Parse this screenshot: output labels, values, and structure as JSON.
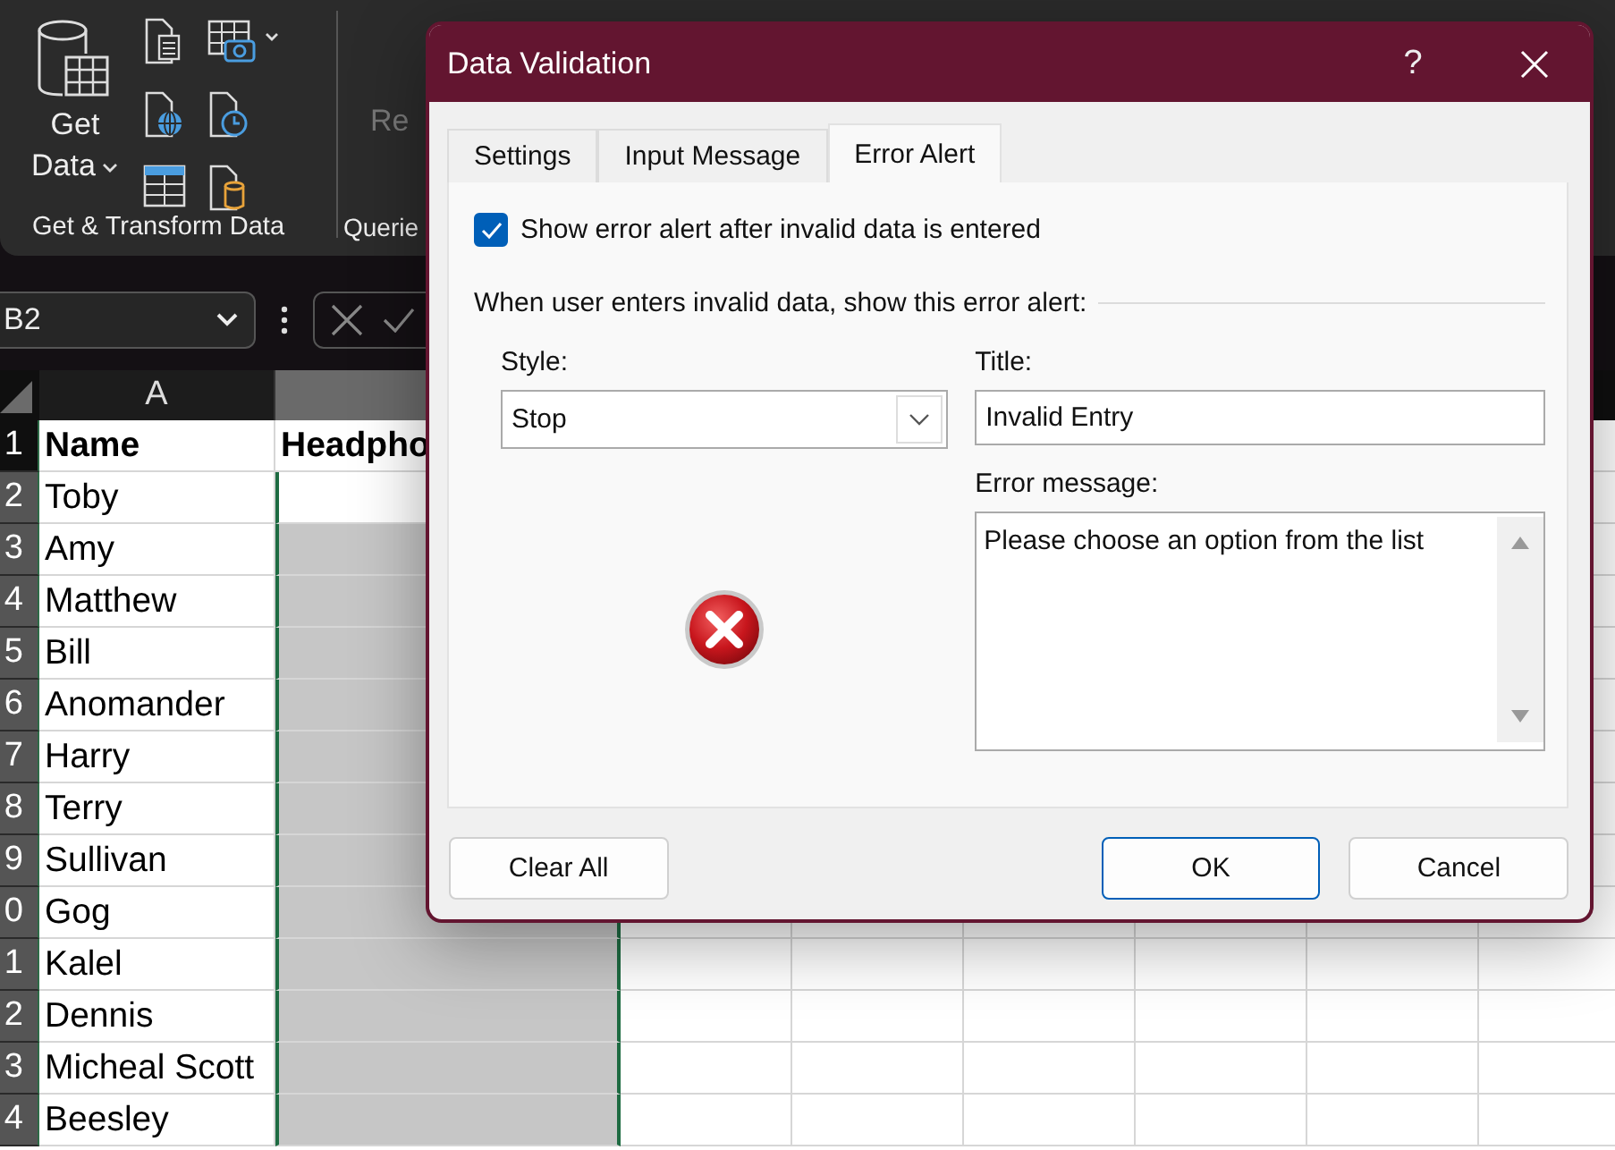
{
  "ribbon": {
    "get_data": "Get Data",
    "groups": [
      {
        "label": "Get & Transform Data"
      },
      {
        "label": "Querie",
        "cut_text": "Re"
      }
    ]
  },
  "formula_bar": {
    "name_box": "B2"
  },
  "sheet": {
    "columns": [
      {
        "label": "A",
        "selected": false
      },
      {
        "selected": true
      }
    ],
    "rows": [
      {
        "number": "1",
        "selected": false,
        "cells": [
          "Name",
          "Headpho"
        ]
      },
      {
        "number": "2",
        "selected": true,
        "active": true,
        "cells": [
          "Toby"
        ]
      },
      {
        "number": "3",
        "selected": true,
        "cells": [
          "Amy"
        ]
      },
      {
        "number": "4",
        "selected": true,
        "cells": [
          "Matthew"
        ]
      },
      {
        "number": "5",
        "selected": true,
        "cells": [
          "Bill"
        ]
      },
      {
        "number": "6",
        "selected": true,
        "cells": [
          "Anomander"
        ]
      },
      {
        "number": "7",
        "selected": true,
        "cells": [
          "Harry"
        ]
      },
      {
        "number": "8",
        "selected": true,
        "cells": [
          "Terry"
        ]
      },
      {
        "number": "9",
        "selected": true,
        "cells": [
          "Sullivan"
        ]
      },
      {
        "number": "0",
        "selected": true,
        "cells": [
          "Gog"
        ]
      },
      {
        "number": "1",
        "selected": true,
        "cells": [
          "Kalel"
        ]
      },
      {
        "number": "2",
        "selected": true,
        "cells": [
          "Dennis"
        ]
      },
      {
        "number": "3",
        "selected": true,
        "cells": [
          "Micheal Scott"
        ]
      },
      {
        "number": "4",
        "selected": true,
        "cells": [
          "Beesley"
        ]
      }
    ]
  },
  "dialog": {
    "title": "Data Validation",
    "help": "?",
    "tabs": [
      {
        "label": "Settings",
        "selected": false
      },
      {
        "label": "Input Message",
        "selected": false
      },
      {
        "label": "Error Alert",
        "selected": true
      }
    ],
    "show_alert": {
      "label": "Show error alert after invalid data is entered",
      "checked": true
    },
    "section_label": "When user enters invalid data, show this error alert:",
    "style": {
      "label": "Style:",
      "value": "Stop"
    },
    "title_field": {
      "label": "Title:",
      "value": "Invalid Entry"
    },
    "message_field": {
      "label": "Error message:",
      "value": "Please choose an option from the list"
    },
    "buttons": [
      {
        "label": "Clear All",
        "default": false
      },
      {
        "label": "OK",
        "default": true
      },
      {
        "label": "Cancel",
        "default": false
      }
    ]
  }
}
